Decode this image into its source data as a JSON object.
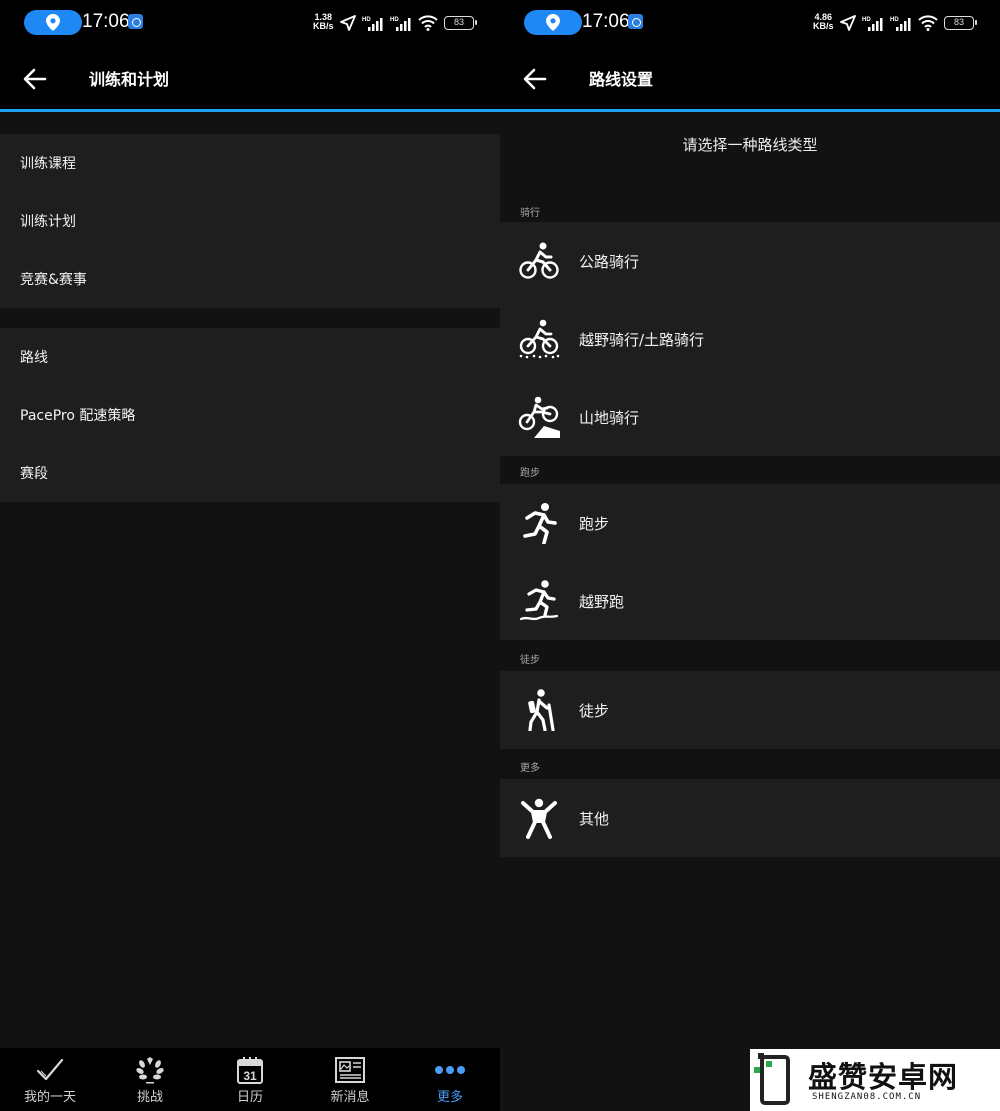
{
  "left_screen": {
    "status_bar": {
      "time": "17:06",
      "net_speed_value": "1.38",
      "net_speed_unit": "KB/s",
      "battery": "83"
    },
    "app_bar": {
      "title": "训练和计划"
    },
    "menu_group_1": [
      {
        "label": "训练课程"
      },
      {
        "label": "训练计划"
      },
      {
        "label": "竞赛&赛事"
      }
    ],
    "menu_group_2": [
      {
        "label": "路线"
      },
      {
        "label": "PacePro 配速策略"
      },
      {
        "label": "赛段"
      }
    ],
    "bottom_nav": [
      {
        "label": "我的一天",
        "icon": "checkmark-icon"
      },
      {
        "label": "挑战",
        "icon": "laurel-icon"
      },
      {
        "label": "日历",
        "icon": "calendar-icon",
        "calendar_day": "31"
      },
      {
        "label": "新消息",
        "icon": "newsfeed-icon"
      },
      {
        "label": "更多",
        "icon": "more-dots-icon",
        "active": true
      }
    ],
    "accent_color": "#1ea1f2",
    "active_nav_color": "#4a9cf5"
  },
  "right_screen": {
    "status_bar": {
      "time": "17:06",
      "net_speed_value": "4.86",
      "net_speed_unit": "KB/s",
      "battery": "83"
    },
    "app_bar": {
      "title": "路线设置"
    },
    "prompt": "请选择一种路线类型",
    "sections": {
      "cycling": {
        "label": "骑行",
        "items": [
          {
            "label": "公路骑行",
            "icon": "road-bike-icon"
          },
          {
            "label": "越野骑行/土路骑行",
            "icon": "gravel-bike-icon"
          },
          {
            "label": "山地骑行",
            "icon": "mountain-bike-icon"
          }
        ]
      },
      "running": {
        "label": "跑步",
        "items": [
          {
            "label": "跑步",
            "icon": "running-icon"
          },
          {
            "label": "越野跑",
            "icon": "trail-run-icon"
          }
        ]
      },
      "hiking": {
        "label": "徒步",
        "items": [
          {
            "label": "徒步",
            "icon": "hiking-icon"
          }
        ]
      },
      "more": {
        "label": "更多",
        "items": [
          {
            "label": "其他",
            "icon": "other-activity-icon"
          }
        ]
      }
    }
  },
  "watermark": {
    "title": "盛赞安卓网",
    "url": "SHENGZAN08.COM.CN"
  }
}
